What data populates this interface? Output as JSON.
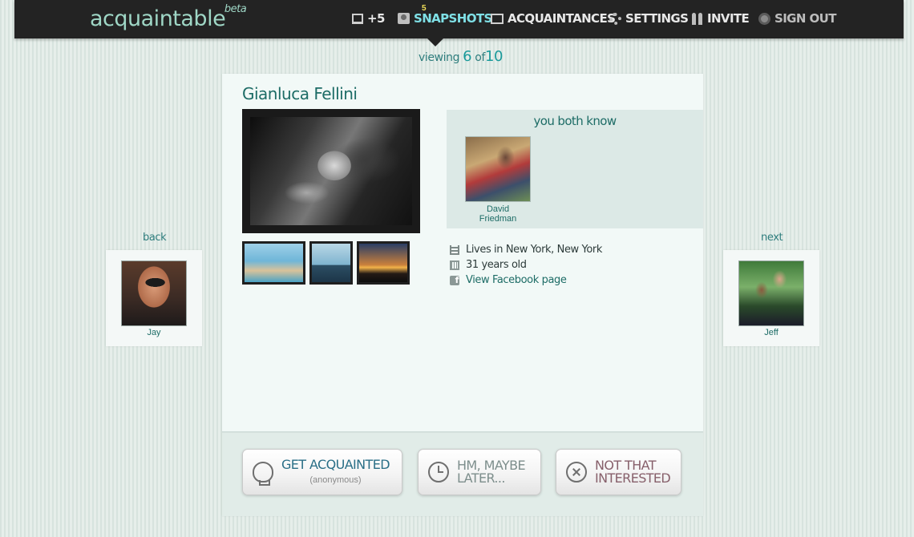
{
  "app": {
    "logo": "acquaintable",
    "logo_badge": "beta"
  },
  "nav": {
    "monitor_count": "+5",
    "snapshots_badge": "5",
    "snapshots": "SNAPSHOTS",
    "acquaintances": "ACQUAINTANCES",
    "settings": "SETTINGS",
    "invite": "INVITE",
    "sign_out": "SIGN OUT"
  },
  "pager": {
    "prefix": "viewing",
    "current": "6",
    "sep": "of",
    "total": "10"
  },
  "profile": {
    "name": "Gianluca Fellini",
    "mutual_title": "you both know",
    "mutual_friends": [
      {
        "name_line1": "David",
        "name_line2": "Friedman"
      }
    ],
    "info": {
      "location": "Lives in New York, New York",
      "age": "31 years old",
      "facebook": "View Facebook page"
    }
  },
  "actions": {
    "get_acquainted": "GET ACQUAINTED",
    "get_acquainted_sub": "(anonymous)",
    "maybe_line1": "HM, MAYBE",
    "maybe_line2": "LATER...",
    "not_line1": "NOT THAT",
    "not_line2": "INTERESTED"
  },
  "side": {
    "back_label": "back",
    "back_name": "Jay",
    "next_label": "next",
    "next_name": "Jeff"
  },
  "icons": {
    "nav": [
      "monitor-icon",
      "person-icon",
      "envelope-icon",
      "gear-icon",
      "people-icon",
      "power-icon"
    ],
    "info": [
      "building-icon",
      "calendar-icon",
      "facebook-icon"
    ],
    "actions": [
      "lightbulb-icon",
      "clock-icon",
      "x-circle-icon"
    ]
  },
  "colors": {
    "topbar": "#232323",
    "accent_teal": "#1d6c66",
    "active_nav": "#7fe0e6",
    "card_bg": "#f2f9f7"
  }
}
